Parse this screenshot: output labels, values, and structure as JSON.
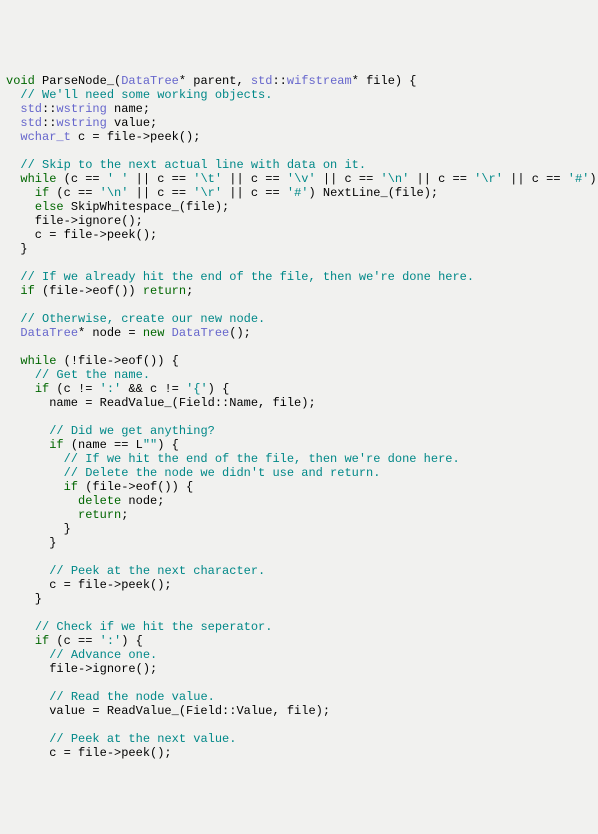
{
  "code": {
    "lines": [
      [
        [
          "kw",
          "void"
        ],
        [
          "",
          " ParseNode_("
        ],
        [
          "tp",
          "DataTree"
        ],
        [
          "",
          "* parent, "
        ],
        [
          "tp",
          "std"
        ],
        [
          "",
          "::"
        ],
        [
          "tp",
          "wifstream"
        ],
        [
          "",
          "* file) {"
        ]
      ],
      [
        [
          "",
          "  "
        ],
        [
          "com",
          "// We'll need some working objects."
        ]
      ],
      [
        [
          "",
          "  "
        ],
        [
          "tp",
          "std"
        ],
        [
          "",
          "::"
        ],
        [
          "tp",
          "wstring"
        ],
        [
          "",
          " name;"
        ]
      ],
      [
        [
          "",
          "  "
        ],
        [
          "tp",
          "std"
        ],
        [
          "",
          "::"
        ],
        [
          "tp",
          "wstring"
        ],
        [
          "",
          " value;"
        ]
      ],
      [
        [
          "",
          "  "
        ],
        [
          "tp",
          "wchar_t"
        ],
        [
          "",
          " c = file->peek();"
        ]
      ],
      [
        [
          "",
          ""
        ]
      ],
      [
        [
          "",
          "  "
        ],
        [
          "com",
          "// Skip to the next actual line with data on it."
        ]
      ],
      [
        [
          "",
          "  "
        ],
        [
          "kw",
          "while"
        ],
        [
          "",
          " (c == "
        ],
        [
          "str",
          "' '"
        ],
        [
          "",
          " || c == "
        ],
        [
          "str",
          "'\\t'"
        ],
        [
          "",
          " || c == "
        ],
        [
          "str",
          "'\\v'"
        ],
        [
          "",
          " || c == "
        ],
        [
          "str",
          "'\\n'"
        ],
        [
          "",
          " || c == "
        ],
        [
          "str",
          "'\\r'"
        ],
        [
          "",
          " || c == "
        ],
        [
          "str",
          "'#'"
        ],
        [
          "",
          ") {"
        ]
      ],
      [
        [
          "",
          "    "
        ],
        [
          "kw",
          "if"
        ],
        [
          "",
          " (c == "
        ],
        [
          "str",
          "'\\n'"
        ],
        [
          "",
          " || c == "
        ],
        [
          "str",
          "'\\r'"
        ],
        [
          "",
          " || c == "
        ],
        [
          "str",
          "'#'"
        ],
        [
          "",
          ") NextLine_(file);"
        ]
      ],
      [
        [
          "",
          "    "
        ],
        [
          "kw",
          "else"
        ],
        [
          "",
          " SkipWhitespace_(file);"
        ]
      ],
      [
        [
          "",
          "    file->ignore();"
        ]
      ],
      [
        [
          "",
          "    c = file->peek();"
        ]
      ],
      [
        [
          "",
          "  }"
        ]
      ],
      [
        [
          "",
          ""
        ]
      ],
      [
        [
          "",
          "  "
        ],
        [
          "com",
          "// If we already hit the end of the file, then we're done here."
        ]
      ],
      [
        [
          "",
          "  "
        ],
        [
          "kw",
          "if"
        ],
        [
          "",
          " (file->eof()) "
        ],
        [
          "kw",
          "return"
        ],
        [
          "",
          ";"
        ]
      ],
      [
        [
          "",
          ""
        ]
      ],
      [
        [
          "",
          "  "
        ],
        [
          "com",
          "// Otherwise, create our new node."
        ]
      ],
      [
        [
          "",
          "  "
        ],
        [
          "tp",
          "DataTree"
        ],
        [
          "",
          "* node = "
        ],
        [
          "kw",
          "new"
        ],
        [
          "",
          " "
        ],
        [
          "tp",
          "DataTree"
        ],
        [
          "",
          "();"
        ]
      ],
      [
        [
          "",
          ""
        ]
      ],
      [
        [
          "",
          "  "
        ],
        [
          "kw",
          "while"
        ],
        [
          "",
          " (!file->eof()) {"
        ]
      ],
      [
        [
          "",
          "    "
        ],
        [
          "com",
          "// Get the name."
        ]
      ],
      [
        [
          "",
          "    "
        ],
        [
          "kw",
          "if"
        ],
        [
          "",
          " (c != "
        ],
        [
          "str",
          "':'"
        ],
        [
          "",
          " && c != "
        ],
        [
          "str",
          "'{'"
        ],
        [
          "",
          ") {"
        ]
      ],
      [
        [
          "",
          "      name = ReadValue_(Field::Name, file);"
        ]
      ],
      [
        [
          "",
          ""
        ]
      ],
      [
        [
          "",
          "      "
        ],
        [
          "com",
          "// Did we get anything?"
        ]
      ],
      [
        [
          "",
          "      "
        ],
        [
          "kw",
          "if"
        ],
        [
          "",
          " (name == L"
        ],
        [
          "str",
          "\"\""
        ],
        [
          "",
          ") {"
        ]
      ],
      [
        [
          "",
          "        "
        ],
        [
          "com",
          "// If we hit the end of the file, then we're done here."
        ]
      ],
      [
        [
          "",
          "        "
        ],
        [
          "com",
          "// Delete the node we didn't use and return."
        ]
      ],
      [
        [
          "",
          "        "
        ],
        [
          "kw",
          "if"
        ],
        [
          "",
          " (file->eof()) {"
        ]
      ],
      [
        [
          "",
          "          "
        ],
        [
          "kw",
          "delete"
        ],
        [
          "",
          " node;"
        ]
      ],
      [
        [
          "",
          "          "
        ],
        [
          "kw",
          "return"
        ],
        [
          "",
          ";"
        ]
      ],
      [
        [
          "",
          "        }"
        ]
      ],
      [
        [
          "",
          "      }"
        ]
      ],
      [
        [
          "",
          ""
        ]
      ],
      [
        [
          "",
          "      "
        ],
        [
          "com",
          "// Peek at the next character."
        ]
      ],
      [
        [
          "",
          "      c = file->peek();"
        ]
      ],
      [
        [
          "",
          "    }"
        ]
      ],
      [
        [
          "",
          ""
        ]
      ],
      [
        [
          "",
          "    "
        ],
        [
          "com",
          "// Check if we hit the seperator."
        ]
      ],
      [
        [
          "",
          "    "
        ],
        [
          "kw",
          "if"
        ],
        [
          "",
          " (c == "
        ],
        [
          "str",
          "':'"
        ],
        [
          "",
          ") {"
        ]
      ],
      [
        [
          "",
          "      "
        ],
        [
          "com",
          "// Advance one."
        ]
      ],
      [
        [
          "",
          "      file->ignore();"
        ]
      ],
      [
        [
          "",
          ""
        ]
      ],
      [
        [
          "",
          "      "
        ],
        [
          "com",
          "// Read the node value."
        ]
      ],
      [
        [
          "",
          "      value = ReadValue_(Field::Value, file);"
        ]
      ],
      [
        [
          "",
          ""
        ]
      ],
      [
        [
          "",
          "      "
        ],
        [
          "com",
          "// Peek at the next value."
        ]
      ],
      [
        [
          "",
          "      c = file->peek();"
        ]
      ]
    ]
  }
}
